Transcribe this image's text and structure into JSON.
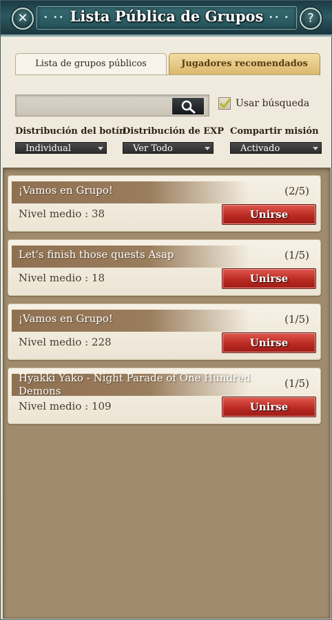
{
  "window": {
    "title": "Lista Pública de Grupos",
    "close_glyph": "✕",
    "help_glyph": "?"
  },
  "tabs": [
    {
      "label": "Lista de grupos públicos",
      "active": true
    },
    {
      "label": "Jugadores recomendados",
      "active": false
    }
  ],
  "search": {
    "value": "",
    "placeholder": "",
    "button_icon": "search-icon",
    "use_search_label": "Usar búsqueda",
    "use_search_checked": true
  },
  "filters": [
    {
      "label": "Distribución del botín",
      "value": "Individual"
    },
    {
      "label": "Distribución de EXP",
      "value": "Ver Todo"
    },
    {
      "label": "Compartir misión",
      "value": "Activado"
    }
  ],
  "groups": [
    {
      "title": "¡Vamos en Grupo!",
      "count": "(2/5)",
      "level": "Nivel medio : 38",
      "join_label": "Unirse"
    },
    {
      "title": "Let's finish those quests Asap",
      "count": "(1/5)",
      "level": "Nivel medio : 18",
      "join_label": "Unirse"
    },
    {
      "title": "¡Vamos en Grupo!",
      "count": "(1/5)",
      "level": "Nivel medio : 228",
      "join_label": "Unirse"
    },
    {
      "title": "Hyakki Yako - Night Parade of One Hundred Demons",
      "count": "(1/5)",
      "level": "Nivel medio : 109",
      "join_label": "Unirse"
    }
  ],
  "colors": {
    "title_bar": "#2c5a63",
    "join_button": "#bb2a22",
    "list_background": "#a08c6c",
    "active_tab": "#f7f3ea",
    "inactive_tab": "#d9b86d"
  }
}
